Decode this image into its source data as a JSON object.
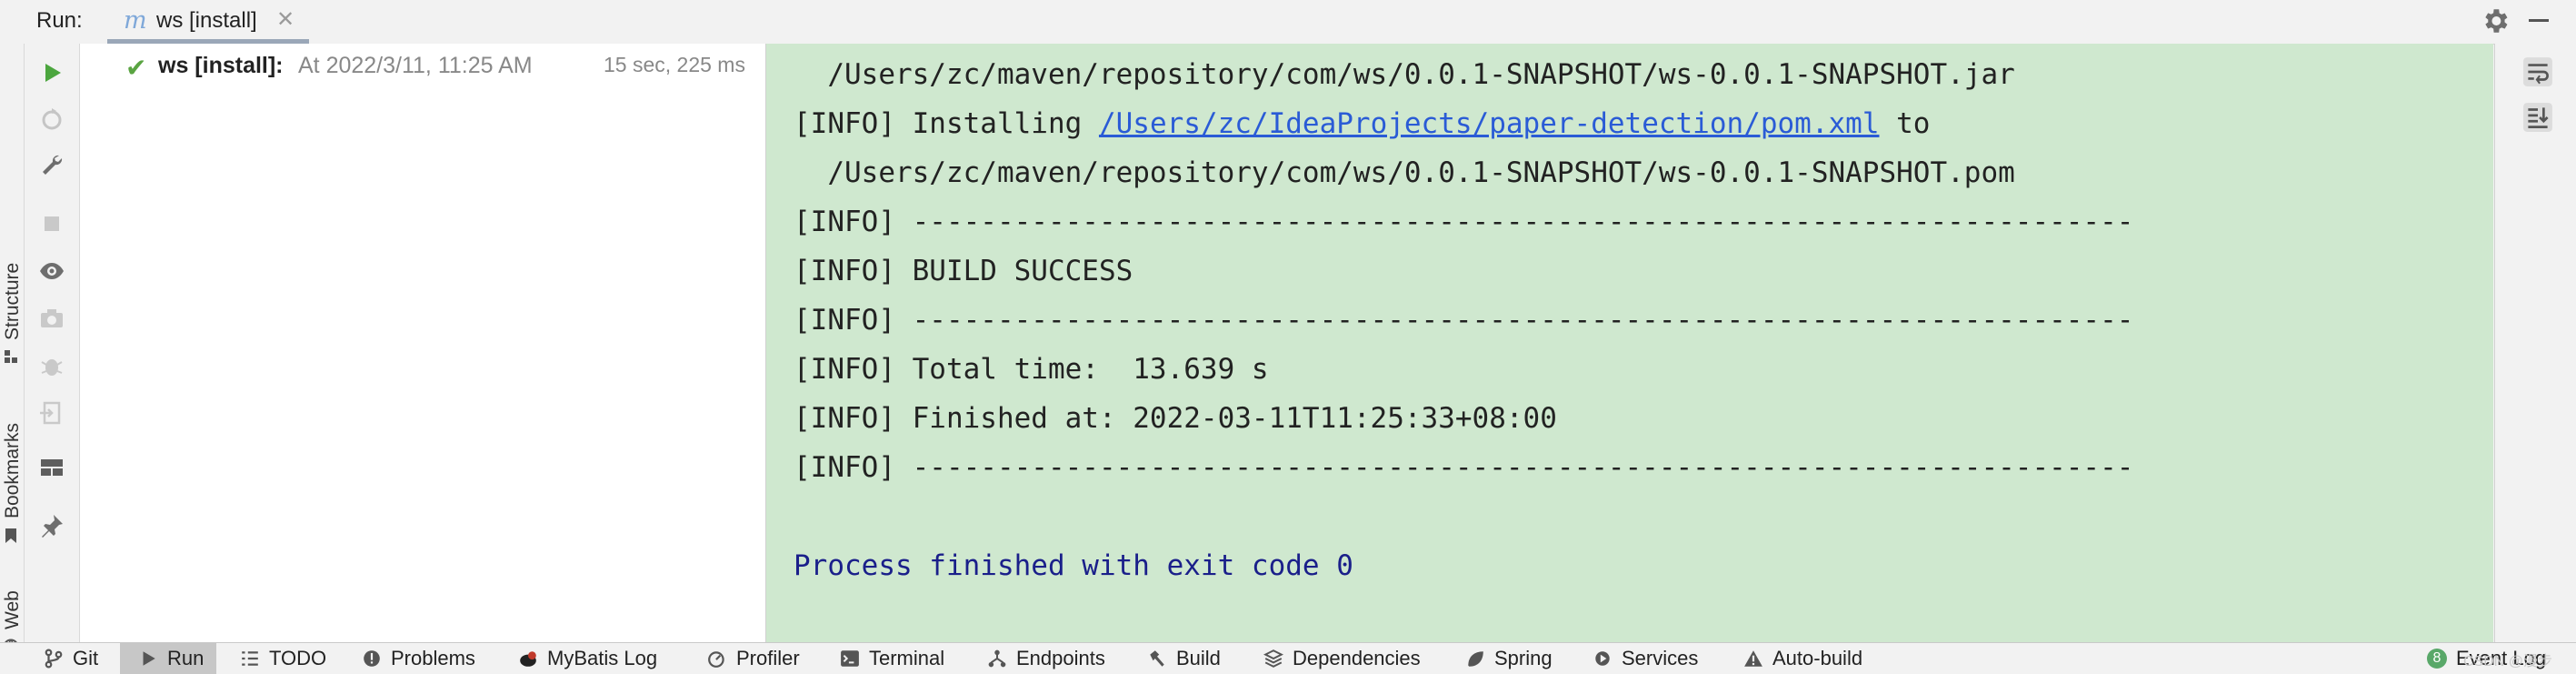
{
  "topbar": {
    "run_label": "Run:",
    "tab": {
      "icon_glyph": "m",
      "label": "ws [install]",
      "close_glyph": "✕"
    }
  },
  "left_strip": {
    "tabs": [
      "Structure",
      "Bookmarks",
      "Web"
    ]
  },
  "tree": {
    "item": {
      "status_glyph": "✔",
      "name": "ws [install]:",
      "time": "At 2022/3/11, 11:25 AM",
      "duration": "15 sec, 225 ms"
    }
  },
  "console": {
    "lines": [
      "  /Users/zc/maven/repository/com/ws/0.0.1-SNAPSHOT/ws-0.0.1-SNAPSHOT.jar",
      "",
      "  /Users/zc/maven/repository/com/ws/0.0.1-SNAPSHOT/ws-0.0.1-SNAPSHOT.pom",
      "[INFO] ------------------------------------------------------------------------",
      "[INFO] BUILD SUCCESS",
      "[INFO] ------------------------------------------------------------------------",
      "[INFO] Total time:  13.639 s",
      "[INFO] Finished at: 2022-03-11T11:25:33+08:00",
      "[INFO] ------------------------------------------------------------------------"
    ],
    "install_line": {
      "prefix": "[INFO] Installing ",
      "link": "/Users/zc/IdeaProjects/paper-detection/pom.xml",
      "suffix": " to"
    },
    "process_line": "Process finished with exit code 0"
  },
  "bottombar": {
    "items": [
      {
        "label": "Git",
        "icon": "git-branch-icon"
      },
      {
        "label": "Run",
        "icon": "run-play-icon"
      },
      {
        "label": "TODO",
        "icon": "todo-list-icon"
      },
      {
        "label": "Problems",
        "icon": "problems-icon"
      },
      {
        "label": "MyBatis Log",
        "icon": "mybatis-bird-icon"
      },
      {
        "label": "Profiler",
        "icon": "profiler-icon"
      },
      {
        "label": "Terminal",
        "icon": "terminal-icon"
      },
      {
        "label": "Endpoints",
        "icon": "endpoints-icon"
      },
      {
        "label": "Build",
        "icon": "hammer-icon"
      },
      {
        "label": "Dependencies",
        "icon": "dependencies-icon"
      },
      {
        "label": "Spring",
        "icon": "spring-leaf-icon"
      },
      {
        "label": "Services",
        "icon": "services-icon"
      },
      {
        "label": "Auto-build",
        "icon": "warning-triangle-icon"
      }
    ],
    "event_log": {
      "label": "Event Log",
      "badge": "8"
    },
    "watermark": "CSDN @漫步"
  },
  "colors": {
    "console_bg": "#cfe8cf",
    "link": "#2a5bd6",
    "process_text": "#1a1f8a",
    "success_check": "#5aa442",
    "run_green": "#4ca63f"
  }
}
